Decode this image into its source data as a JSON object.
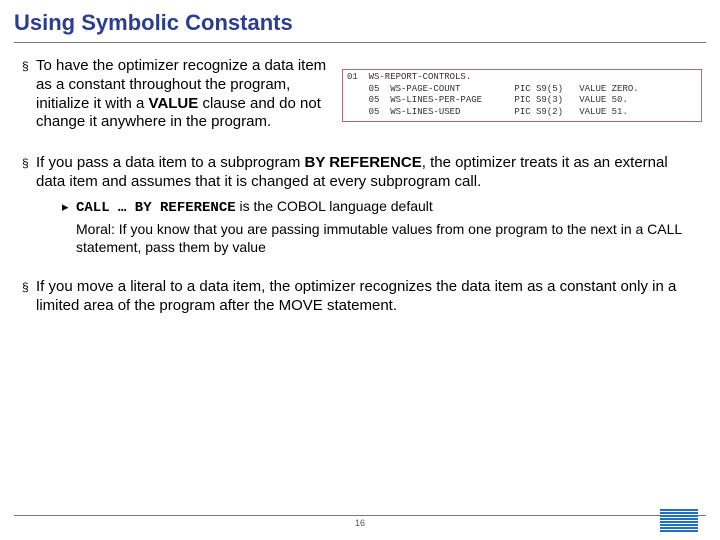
{
  "title": "Using Symbolic Constants",
  "bullets": {
    "b1_pre": "To have the optimizer recognize a data item as a constant throughout the program, initialize it with a ",
    "b1_bold": "VALUE",
    "b1_post": " clause and do not change it anywhere in the program.",
    "b2_pre": "If you pass a data item to a subprogram ",
    "b2_bold": "BY REFERENCE",
    "b2_post": ", the optimizer treats it as an external data item and assumes that it is changed at every subprogram call.",
    "sub_mono": "CALL … BY REFERENCE",
    "sub_rest": " is the COBOL language default",
    "moral": "Moral: If you know that you are passing immutable values from one program to the next in a CALL statement, pass them by value",
    "b3": "If you move a literal to a data item, the optimizer recognizes the data item as a constant only in a limited area of the program after the MOVE statement."
  },
  "code": "01  WS-REPORT-CONTROLS.\n    05  WS-PAGE-COUNT          PIC S9(5)   VALUE ZERO.\n    05  WS-LINES-PER-PAGE      PIC S9(3)   VALUE 50.\n    05  WS-LINES-USED          PIC S9(2)   VALUE 51.",
  "page_number": "16"
}
